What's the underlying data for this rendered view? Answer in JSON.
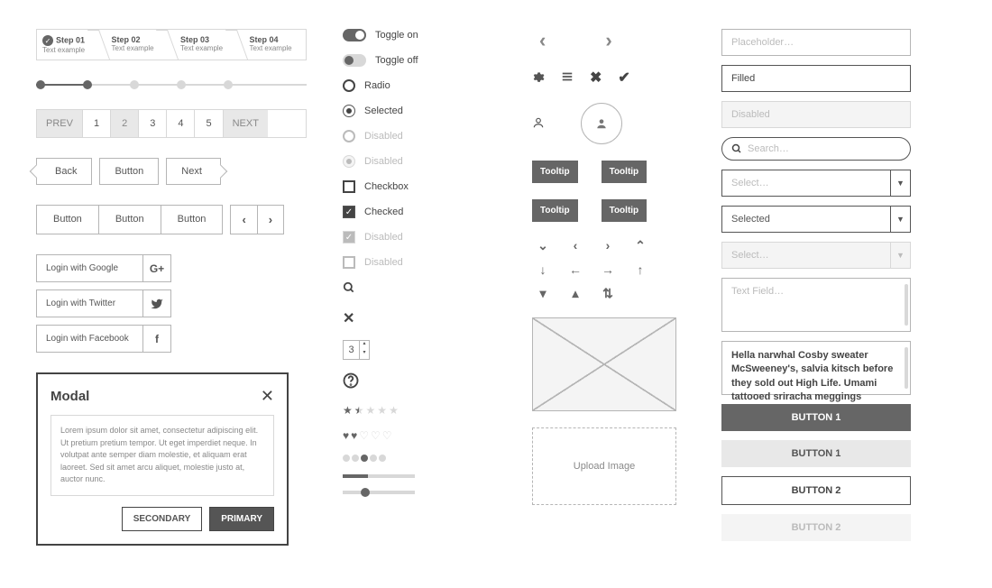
{
  "steps": [
    {
      "title": "Step 01",
      "sub": "Text example",
      "done": true
    },
    {
      "title": "Step 02",
      "sub": "Text example"
    },
    {
      "title": "Step 03",
      "sub": "Text example"
    },
    {
      "title": "Step 04",
      "sub": "Text example"
    }
  ],
  "pager": {
    "prev": "PREV",
    "next": "NEXT",
    "pages": [
      "1",
      "2",
      "3",
      "4",
      "5"
    ]
  },
  "nav": {
    "back": "Back",
    "button": "Button",
    "next": "Next"
  },
  "btngrp": [
    "Button",
    "Button",
    "Button"
  ],
  "social": {
    "google": "Login with Google",
    "twitter": "Login with Twitter",
    "facebook": "Login with Facebook",
    "google_icon": "G+",
    "twitter_icon": "t",
    "facebook_icon": "f"
  },
  "modal": {
    "title": "Modal",
    "body": "Lorem ipsum dolor sit amet, consectetur adipiscing elit. Ut pretium pretium tempor. Ut eget imperdiet neque. In volutpat ante semper diam molestie, et aliquam erat laoreet. Sed sit amet arcu aliquet, molestie justo at, auctor nunc.",
    "secondary": "SECONDARY",
    "primary": "PRIMARY"
  },
  "toggles": {
    "on": "Toggle on",
    "off": "Toggle off"
  },
  "radios": {
    "radio": "Radio",
    "selected": "Selected",
    "disabled": "Disabled",
    "disabled_sel": "Disabled"
  },
  "checks": {
    "checkbox": "Checkbox",
    "checked": "Checked",
    "disabled_sel": "Disabled",
    "disabled": "Disabled"
  },
  "stepper": {
    "value": "3"
  },
  "tooltips": {
    "t1": "Tooltip",
    "t2": "Tooltip",
    "t3": "Tooltip",
    "t4": "Tooltip"
  },
  "upload": "Upload Image",
  "inputs": {
    "placeholder": "Placeholder…",
    "filled": "Filled",
    "disabled": "Disabled",
    "search": "Search…",
    "select_ph": "Select…",
    "selected": "Selected",
    "select_dis": "Select…",
    "textarea_ph": "Text Field…",
    "textarea_filled": "Hella narwhal Cosby sweater McSweeney's, salvia kitsch before they sold out High Life. Umami tattooed sriracha meggings"
  },
  "buttons": {
    "b1": "BUTTON 1",
    "b1g": "BUTTON 1",
    "b2": "BUTTON 2",
    "b2f": "BUTTON 2"
  }
}
